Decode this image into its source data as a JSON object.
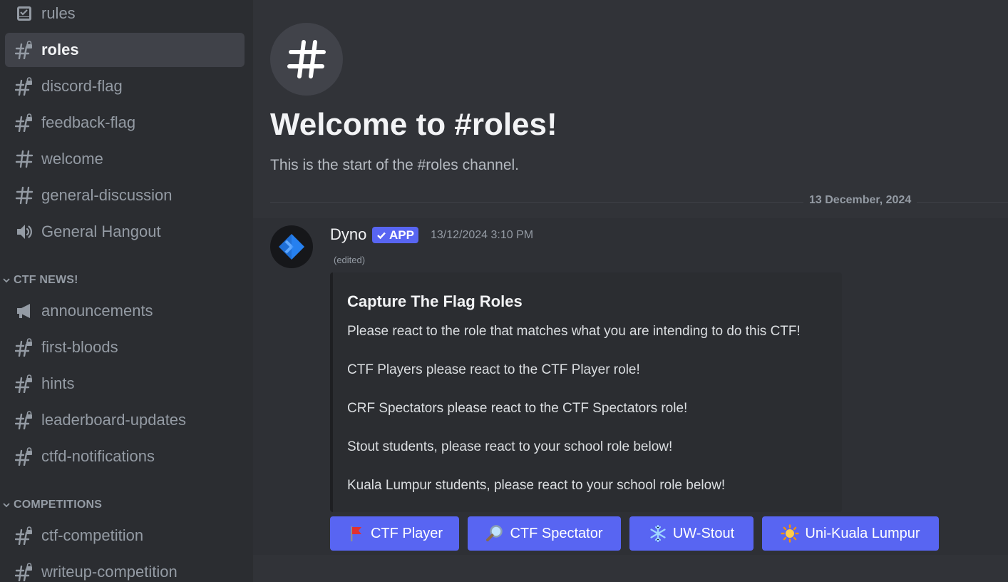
{
  "sidebar": {
    "channels_top": [
      {
        "label": "rules",
        "icon": "rules-icon"
      },
      {
        "label": "roles",
        "icon": "locked-hash-icon",
        "active": true
      },
      {
        "label": "discord-flag",
        "icon": "locked-hash-icon"
      },
      {
        "label": "feedback-flag",
        "icon": "locked-hash-icon"
      },
      {
        "label": "welcome",
        "icon": "hash-icon"
      },
      {
        "label": "general-discussion",
        "icon": "hash-icon"
      },
      {
        "label": "General Hangout",
        "icon": "speaker-icon"
      }
    ],
    "categories": [
      {
        "name": "CTF NEWS!",
        "channels": [
          {
            "label": "announcements",
            "icon": "megaphone-icon"
          },
          {
            "label": "first-bloods",
            "icon": "locked-hash-icon"
          },
          {
            "label": "hints",
            "icon": "locked-hash-icon"
          },
          {
            "label": "leaderboard-updates",
            "icon": "locked-hash-icon"
          },
          {
            "label": "ctfd-notifications",
            "icon": "locked-hash-icon"
          }
        ]
      },
      {
        "name": "COMPETITIONS",
        "channels": [
          {
            "label": "ctf-competition",
            "icon": "locked-hash-icon"
          },
          {
            "label": "writeup-competition",
            "icon": "locked-hash-icon"
          }
        ]
      }
    ]
  },
  "main": {
    "welcome_title": "Welcome to #roles!",
    "welcome_subtitle": "This is the start of the #roles channel.",
    "date_divider": "13 December, 2024",
    "message": {
      "author": "Dyno",
      "badge": "APP",
      "timestamp": "13/12/2024 3:10 PM",
      "edited": "(edited)",
      "embed": {
        "title": "Capture The Flag Roles",
        "lines": [
          "Please react to the role that matches what you are intending to do this CTF!",
          "CTF Players please react to the CTF Player role!",
          "CRF Spectators please react to the CTF Spectators role!",
          "Stout students, please react to your school role below!",
          "Kuala Lumpur students, please react to your school role below!"
        ]
      },
      "buttons": [
        {
          "label": "CTF Player",
          "emoji": "red-flag-icon"
        },
        {
          "label": "CTF Spectator",
          "emoji": "magnifier-icon"
        },
        {
          "label": "UW-Stout",
          "emoji": "snowflake-icon"
        },
        {
          "label": "Uni-Kuala Lumpur",
          "emoji": "sun-icon"
        }
      ]
    }
  },
  "colors": {
    "accent": "#5865f2",
    "sidebar_bg": "#2b2d31",
    "main_bg": "#313338",
    "active_channel": "#404249"
  }
}
